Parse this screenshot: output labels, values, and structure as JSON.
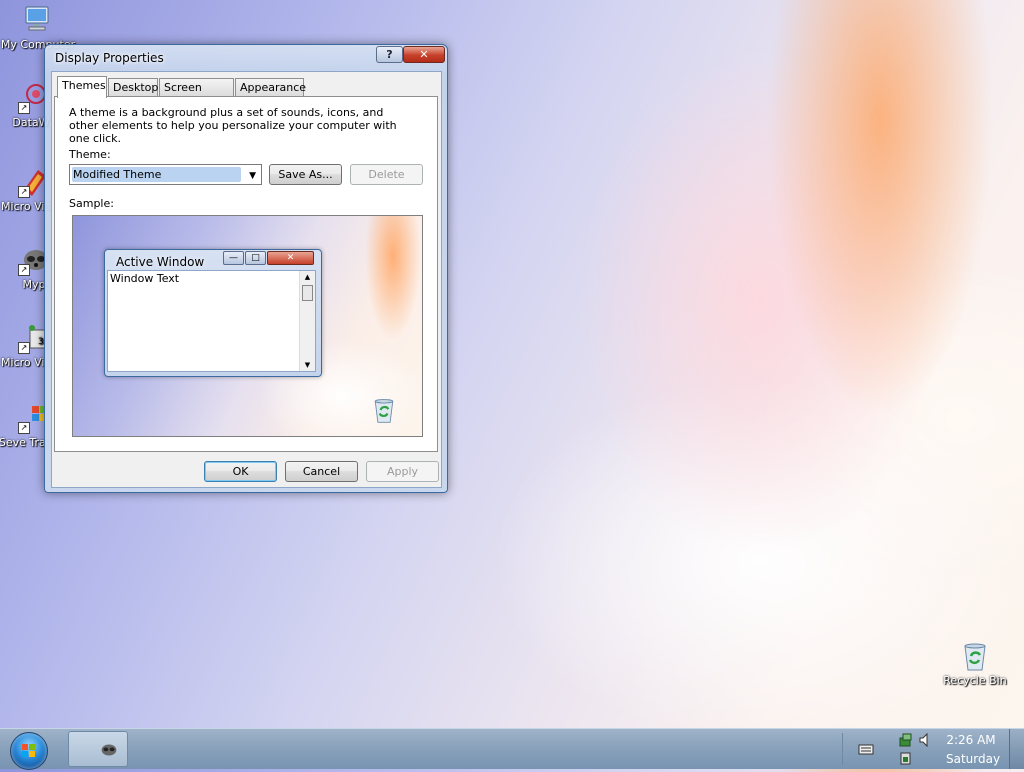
{
  "desktop": {
    "icons": [
      {
        "label": "My Computer"
      },
      {
        "label": "DataWa"
      },
      {
        "label": "Micro Visual"
      },
      {
        "label": "Myp"
      },
      {
        "label": "Micro Visual"
      },
      {
        "label": "Seve Transfo"
      },
      {
        "label": "Recycle Bin"
      }
    ]
  },
  "dialog": {
    "title": "Display Properties",
    "help_label": "?",
    "close_label": "✕",
    "tabs": [
      {
        "label": "Themes"
      },
      {
        "label": "Desktop"
      },
      {
        "label": "Screen Saver"
      },
      {
        "label": "Appearance"
      }
    ],
    "active_tab": "Themes",
    "description": "A theme is a background plus a set of sounds, icons, and other elements to help you personalize your computer with one click.",
    "theme_label": "Theme:",
    "theme_value": "Modified Theme",
    "save_as_label": "Save As...",
    "delete_label": "Delete",
    "sample_label": "Sample:",
    "sample": {
      "window_title": "Active Window",
      "window_text": "Window Text"
    },
    "ok_label": "OK",
    "cancel_label": "Cancel",
    "apply_label": "Apply"
  },
  "taskbar": {
    "clock_time": "2:26 AM",
    "clock_day": "Saturday"
  },
  "colors": {
    "accent": "#3d6a9e",
    "selection": "#b9d3f0",
    "close_red": "#c7402a"
  }
}
